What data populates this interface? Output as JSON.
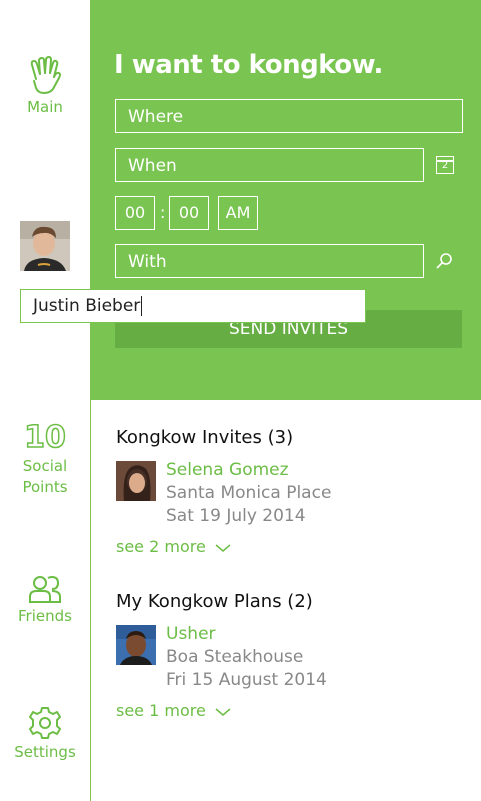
{
  "colors": {
    "accent": "#7ac552",
    "accent_dark": "#66ad44",
    "text_green": "#6cbd45"
  },
  "sidebar": {
    "main_label": "Main",
    "points_value": "10",
    "points_label_1": "Social",
    "points_label_2": "Points",
    "friends_label": "Friends",
    "settings_label": "Settings"
  },
  "hero": {
    "title": "I want to kongkow.",
    "where_placeholder": "Where",
    "when_placeholder": "When",
    "calendar_day": "2",
    "hour": "00",
    "minute": "00",
    "ampm": "AM",
    "colon": ":",
    "with_placeholder": "With",
    "send_label": "SEND INVITES"
  },
  "autocomplete": {
    "value": "Justin Bieber"
  },
  "invites": {
    "title": "Kongkow Invites (3)",
    "item": {
      "name": "Selena Gomez",
      "place": "Santa Monica Place",
      "date": "Sat 19 July 2014"
    },
    "see_more": "see 2 more"
  },
  "plans": {
    "title": "My Kongkow Plans (2)",
    "item": {
      "name": "Usher",
      "place": "Boa Steakhouse",
      "date": "Fri 15 August 2014"
    },
    "see_more": "see 1 more"
  }
}
